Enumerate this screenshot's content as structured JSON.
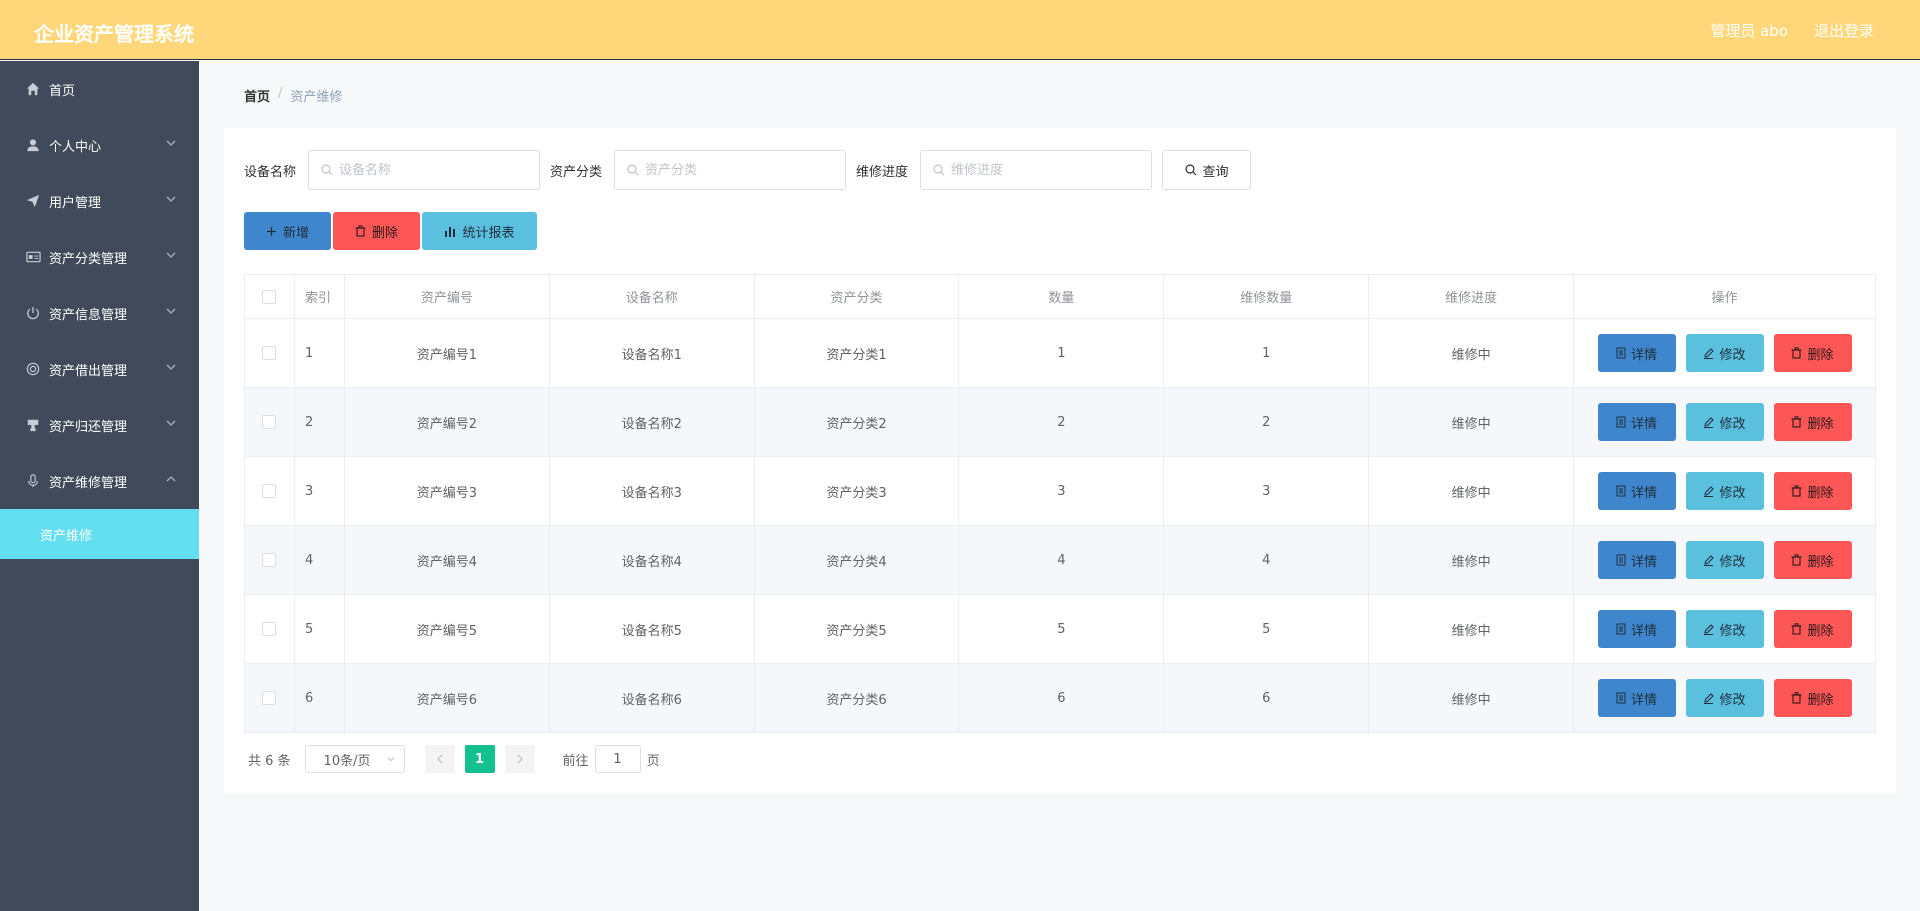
{
  "header": {
    "title": "企业资产管理系统",
    "user": "管理员 abo",
    "logout": "退出登录"
  },
  "sidebar": {
    "items": [
      {
        "label": "首页",
        "icon": "home-icon"
      },
      {
        "label": "个人中心",
        "icon": "user-icon"
      },
      {
        "label": "用户管理",
        "icon": "send-icon"
      },
      {
        "label": "资产分类管理",
        "icon": "id-card-icon"
      },
      {
        "label": "资产信息管理",
        "icon": "power-icon"
      },
      {
        "label": "资产借出管理",
        "icon": "lifebuoy-icon"
      },
      {
        "label": "资产归还管理",
        "icon": "stamp-icon"
      },
      {
        "label": "资产维修管理",
        "icon": "microphone-icon"
      }
    ],
    "active_sub": "资产维修"
  },
  "breadcrumb": {
    "home": "首页",
    "separator": "/",
    "current": "资产维修"
  },
  "search": {
    "fields": [
      {
        "label": "设备名称",
        "placeholder": "设备名称"
      },
      {
        "label": "资产分类",
        "placeholder": "资产分类"
      },
      {
        "label": "维修进度",
        "placeholder": "维修进度"
      }
    ],
    "query_label": "查询"
  },
  "actions": {
    "add": "新增",
    "delete": "删除",
    "stats": "统计报表"
  },
  "table": {
    "columns": [
      "索引",
      "资产编号",
      "设备名称",
      "资产分类",
      "数量",
      "维修数量",
      "维修进度",
      "操作"
    ],
    "rows": [
      {
        "index": "1",
        "asset_no": "资产编号1",
        "device": "设备名称1",
        "category": "资产分类1",
        "qty": "1",
        "repair_qty": "1",
        "progress": "维修中"
      },
      {
        "index": "2",
        "asset_no": "资产编号2",
        "device": "设备名称2",
        "category": "资产分类2",
        "qty": "2",
        "repair_qty": "2",
        "progress": "维修中"
      },
      {
        "index": "3",
        "asset_no": "资产编号3",
        "device": "设备名称3",
        "category": "资产分类3",
        "qty": "3",
        "repair_qty": "3",
        "progress": "维修中"
      },
      {
        "index": "4",
        "asset_no": "资产编号4",
        "device": "设备名称4",
        "category": "资产分类4",
        "qty": "4",
        "repair_qty": "4",
        "progress": "维修中"
      },
      {
        "index": "5",
        "asset_no": "资产编号5",
        "device": "设备名称5",
        "category": "资产分类5",
        "qty": "5",
        "repair_qty": "5",
        "progress": "维修中"
      },
      {
        "index": "6",
        "asset_no": "资产编号6",
        "device": "设备名称6",
        "category": "资产分类6",
        "qty": "6",
        "repair_qty": "6",
        "progress": "维修中"
      }
    ],
    "op_labels": {
      "detail": "详情",
      "edit": "修改",
      "delete": "删除"
    }
  },
  "pagination": {
    "total": "共 6 条",
    "page_size": "10条/页",
    "current_page": "1",
    "goto_prefix": "前往",
    "goto_value": "1",
    "goto_suffix": "页"
  },
  "colors": {
    "header_bg": "#ffd77a",
    "sidebar_bg": "#414a5b",
    "active_sub_bg": "#64dff0",
    "primary": "#3f86cc",
    "info": "#5bc0de",
    "danger": "#fd5656",
    "pager_active": "#13c08f"
  }
}
